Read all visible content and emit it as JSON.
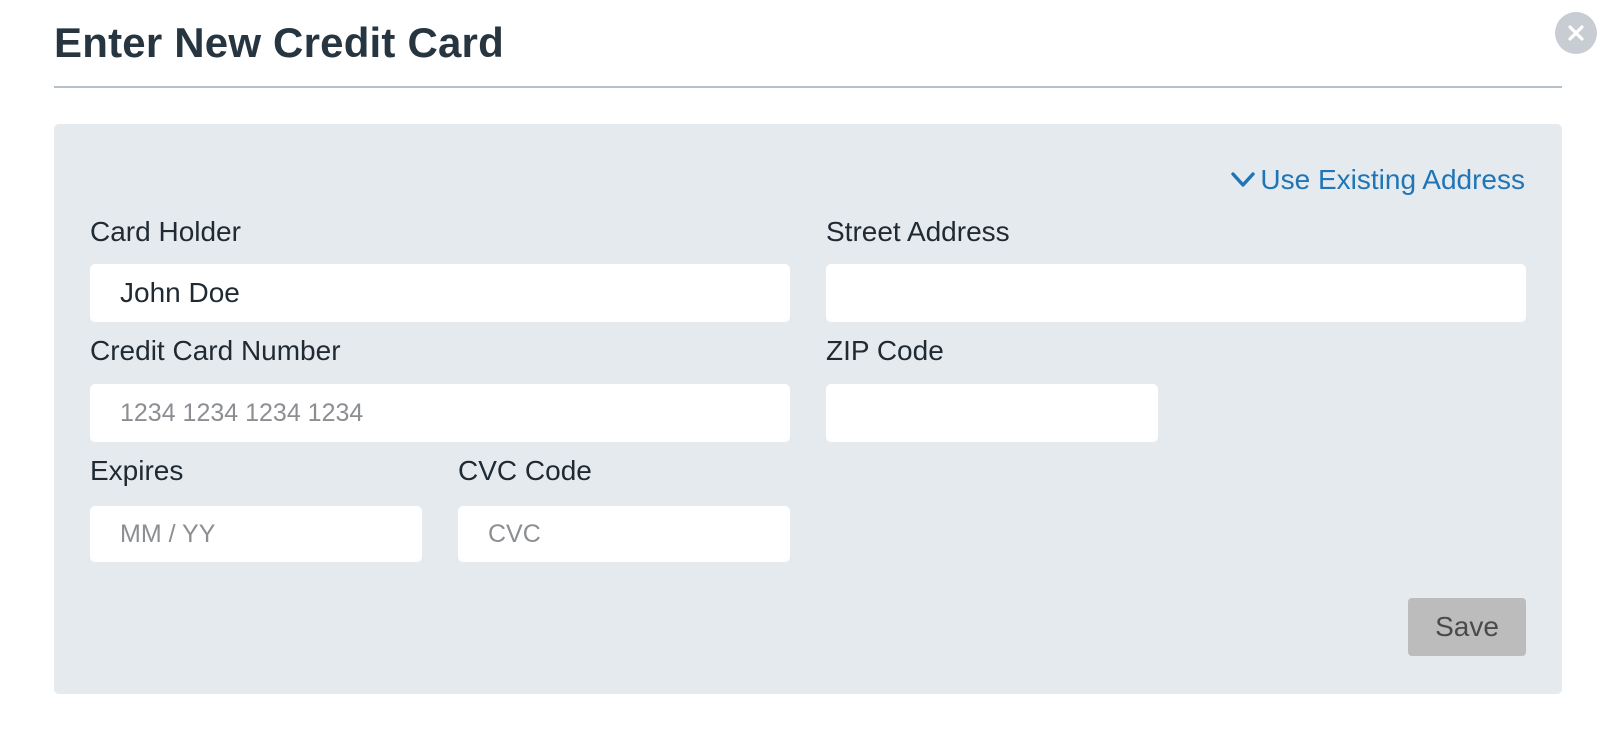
{
  "modal": {
    "title": "Enter New Credit Card",
    "close_icon": "close-icon"
  },
  "form": {
    "use_existing_address": {
      "label": "Use Existing Address",
      "icon": "chevron-down-icon"
    },
    "card_holder": {
      "label": "Card Holder",
      "value": "John Doe",
      "placeholder": ""
    },
    "credit_card_number": {
      "label": "Credit Card Number",
      "value": "",
      "placeholder": "1234 1234 1234 1234"
    },
    "expires": {
      "label": "Expires",
      "value": "",
      "placeholder": "MM / YY"
    },
    "cvc_code": {
      "label": "CVC Code",
      "value": "",
      "placeholder": "CVC"
    },
    "street_address": {
      "label": "Street Address",
      "value": "",
      "placeholder": ""
    },
    "zip_code": {
      "label": "ZIP Code",
      "value": "",
      "placeholder": ""
    },
    "save_label": "Save"
  },
  "colors": {
    "title": "#263540",
    "link": "#1f75b5",
    "panel_bg": "#e5eaee",
    "save_disabled_bg": "#bcbcbc"
  }
}
